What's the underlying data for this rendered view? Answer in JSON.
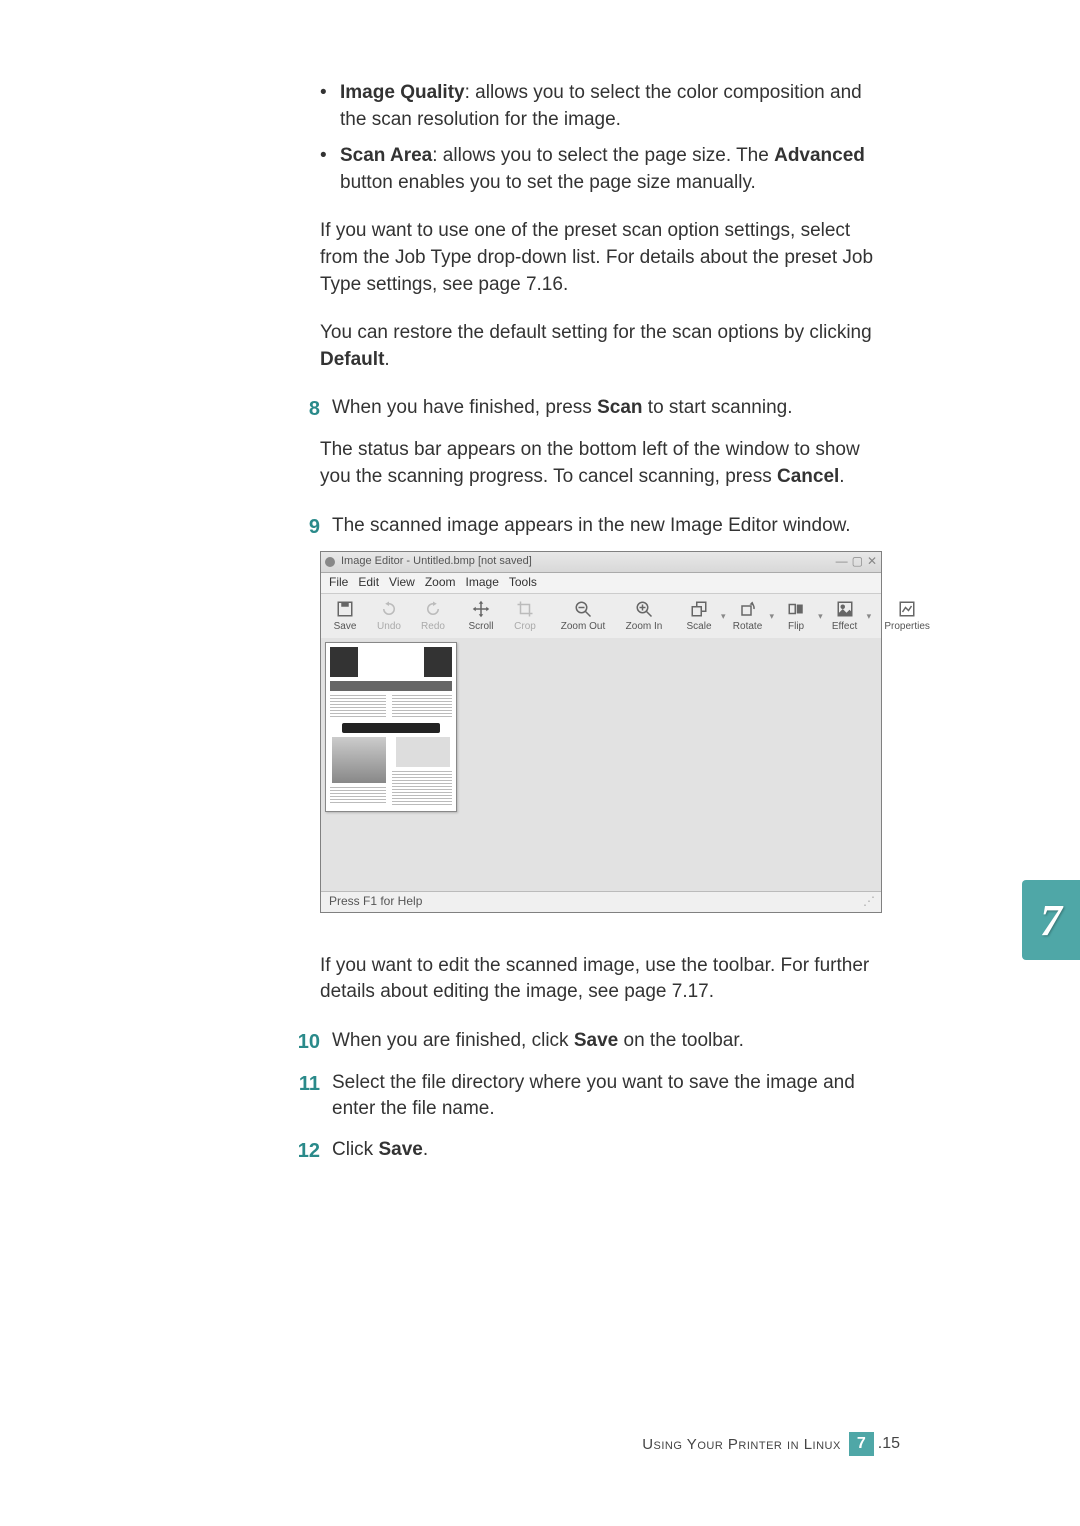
{
  "bullets": {
    "b1_label": "Image Quality",
    "b1_text": ": allows you to select the color composition and the scan resolution for the image.",
    "b2_label": "Scan Area",
    "b2_text_a": ": allows you to select the page size. The ",
    "b2_text_b": "Advanced",
    "b2_text_c": " button enables you to set the page size manually."
  },
  "paras": {
    "p1": "If you want to use one of the preset scan option settings, select from the Job Type drop-down list. For details about the preset Job Type settings, see page 7.16.",
    "p2a": "You can restore the default setting for the scan options by clicking ",
    "p2b": "Default",
    "p2c": "."
  },
  "steps": {
    "s8": "8",
    "s8a": "When you have finished, press ",
    "s8b": "Scan",
    "s8c": " to start scanning.",
    "s8p_a": "The status bar appears on the bottom left of the window to show you the scanning progress. To cancel scanning, press ",
    "s8p_b": "Cancel",
    "s8p_c": ".",
    "s9": "9",
    "s9a": "The scanned image appears in the new Image Editor window.",
    "s9p": "If you want to edit the scanned image, use the toolbar. For further details about editing the image, see page 7.17.",
    "s10": "10",
    "s10a": "When you are finished, click ",
    "s10b": "Save",
    "s10c": " on the toolbar.",
    "s11": "11",
    "s11a": "Select the file directory where you want to save the image and enter the file name.",
    "s12": "12",
    "s12a": "Click ",
    "s12b": "Save",
    "s12c": "."
  },
  "screenshot": {
    "title": "Image Editor - Untitled.bmp [not saved]",
    "win_min": "—",
    "win_max": "▢",
    "win_close": "✕",
    "menu": {
      "file": "File",
      "edit": "Edit",
      "view": "View",
      "zoom": "Zoom",
      "image": "Image",
      "tools": "Tools"
    },
    "toolbar": {
      "save": "Save",
      "undo": "Undo",
      "redo": "Redo",
      "scroll": "Scroll",
      "crop": "Crop",
      "zoomout": "Zoom Out",
      "zoomin": "Zoom In",
      "scale": "Scale",
      "rotate": "Rotate",
      "flip": "Flip",
      "effect": "Effect",
      "properties": "Properties"
    },
    "status": "Press F1 for Help"
  },
  "thumb": "7",
  "footer": {
    "text": "Using Your Printer in Linux",
    "chapter": "7",
    "page": ".15"
  }
}
